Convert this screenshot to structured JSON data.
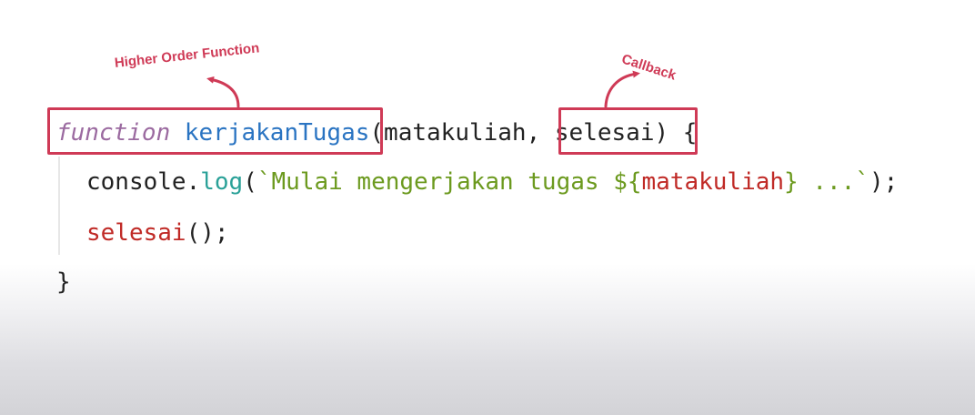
{
  "annotations": {
    "higher_order": "Higher Order Function",
    "callback": "Callback"
  },
  "code": {
    "line1": {
      "keyword": "function",
      "space": " ",
      "name": "kerjakanTugas",
      "open_paren": "(",
      "param1": "matakuliah",
      "comma": ", ",
      "param2": "selesai",
      "close": ") {"
    },
    "line2": {
      "object": "console",
      "dot": ".",
      "method": "log",
      "open_paren": "(",
      "string_start": "`Mulai mengerjakan tugas ${",
      "interpolation": "matakuliah",
      "string_end": "} ...`",
      "close": ");"
    },
    "line3": {
      "call": "selesai",
      "close": "();"
    },
    "line4": {
      "brace": "}"
    }
  },
  "colors": {
    "annotation": "#cf3a56",
    "keyword": "#9b6aa0",
    "function_name": "#2a74c2",
    "method": "#2aa198",
    "string": "#6c9a1f",
    "variable": "#c02a26"
  }
}
